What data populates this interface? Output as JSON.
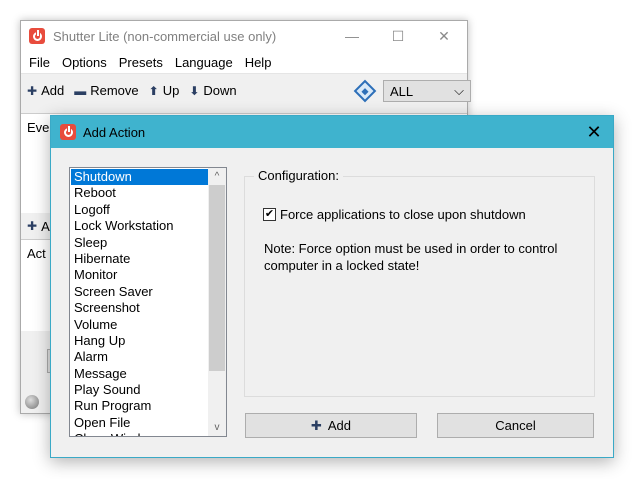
{
  "main_window": {
    "title": "Shutter Lite (non-commercial use only)",
    "controls": {
      "minimize": "—",
      "maximize": "☐",
      "close": "✕"
    },
    "menu": [
      "File",
      "Options",
      "Presets",
      "Language",
      "Help"
    ],
    "toolbar": {
      "add_glyph": "✚",
      "add_label": "Add",
      "remove_glyph": "▬",
      "remove_label": "Remove",
      "up_glyph": "⬆",
      "up_label": "Up",
      "down_glyph": "⬇",
      "down_label": "Down",
      "filter_value": "ALL",
      "filter_arrow": "⌵"
    },
    "events_header_partial": "Eve",
    "actions_toolbar_glyph": "✚",
    "actions_toolbar_partial": "A",
    "actions_header_partial": "Act"
  },
  "dialog": {
    "title": "Add Action",
    "close": "✕",
    "actions": [
      "Shutdown",
      "Reboot",
      "Logoff",
      "Lock Workstation",
      "Sleep",
      "Hibernate",
      "Monitor",
      "Screen Saver",
      "Screenshot",
      "Volume",
      "Hang Up",
      "Alarm",
      "Message",
      "Play Sound",
      "Run Program",
      "Open File",
      "Close Window"
    ],
    "selected_action": "Shutdown",
    "scroll_up": "^",
    "scroll_down": "v",
    "config_label": "Configuration:",
    "force_checkbox_label": "Force applications to close upon shutdown",
    "force_checked": true,
    "check_mark": "✔",
    "note": "Note: Force option must be used in order to control computer in a locked state!",
    "add_button_glyph": "✚",
    "add_button_label": "Add",
    "cancel_button_label": "Cancel"
  },
  "colors": {
    "dialog_titlebar": "#3fb3ce",
    "selection": "#0078d7",
    "app_icon": "#e84c3d"
  }
}
